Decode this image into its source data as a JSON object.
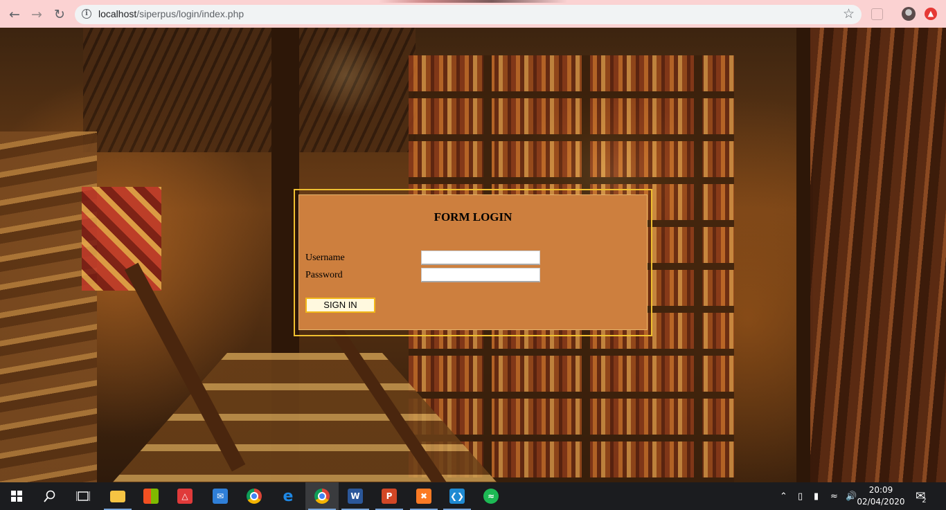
{
  "browser": {
    "url_host": "localhost",
    "url_path": "/siperpus/login/index.php",
    "back_icon": "arrow-left-icon",
    "forward_icon": "arrow-right-icon",
    "reload_icon": "reload-icon",
    "bookmark_icon": "star-icon"
  },
  "form": {
    "title": "FORM LOGIN",
    "username_label": "Username",
    "password_label": "Password",
    "username_value": "",
    "password_value": "",
    "submit_label": "SIGN IN"
  },
  "taskbar": {
    "apps": [
      "start",
      "search",
      "task-view",
      "file-explorer",
      "microsoft-store",
      "gift",
      "mail",
      "chrome",
      "edge",
      "chrome-active",
      "word",
      "powerpoint",
      "xampp",
      "vscode",
      "spotify"
    ],
    "time": "20:09",
    "date": "02/04/2020",
    "notification_count": "2"
  },
  "colors": {
    "panel": "#cd7f3e",
    "frame": "#f0c030",
    "button_border": "#f2b81a",
    "chrome_bar": "#fbd2d2"
  }
}
